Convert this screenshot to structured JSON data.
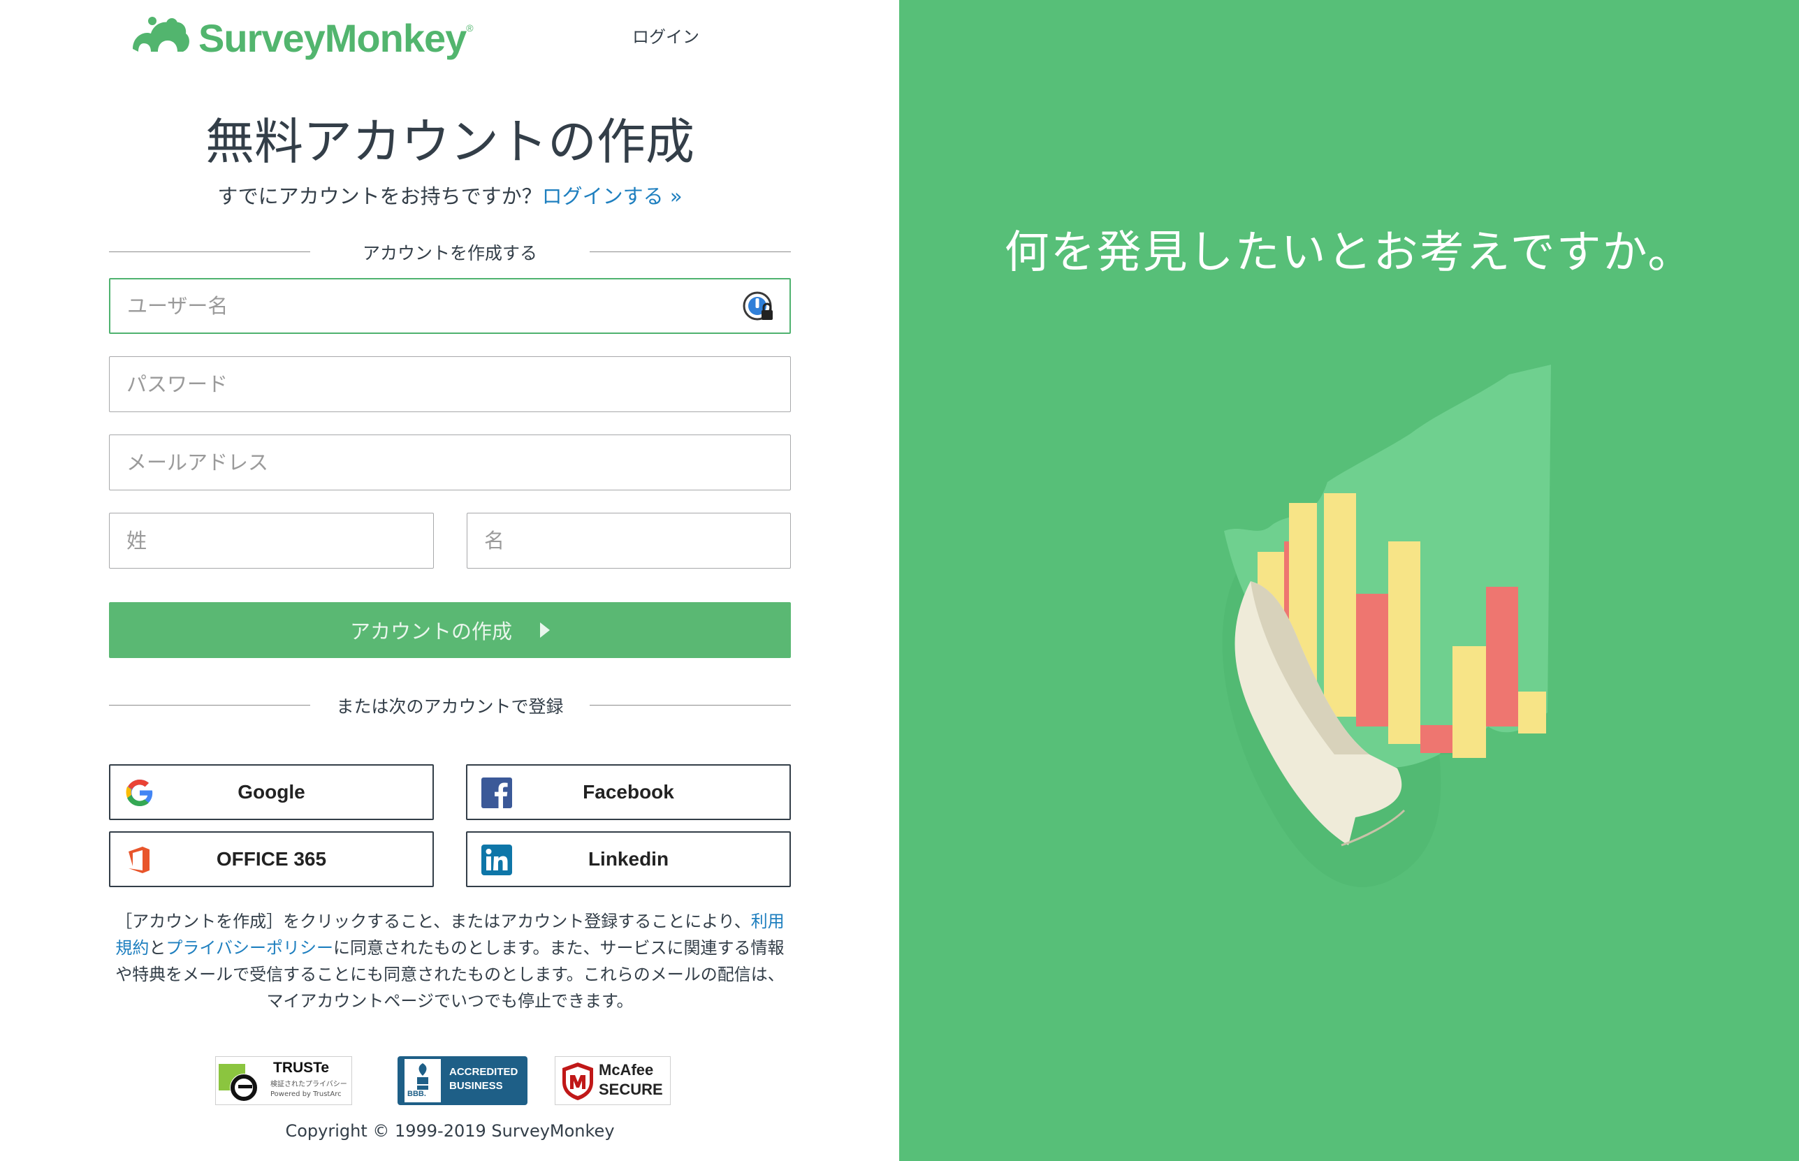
{
  "header": {
    "brand": "SurveyMonkey",
    "trademark": "®",
    "login_link": "ログイン"
  },
  "form": {
    "title": "無料アカウントの作成",
    "subtitle_prefix": "すでにアカウントをお持ちですか？",
    "subtitle_link": "ログインする »",
    "divider_label": "アカウントを作成する",
    "username_placeholder": "ユーザー名",
    "password_placeholder": "パスワード",
    "email_placeholder": "メールアドレス",
    "last_name_placeholder": "姓",
    "first_name_placeholder": "名",
    "submit_label": "アカウントの作成",
    "social_divider_label": "または次のアカウントで登録",
    "focused_field": "username"
  },
  "social": {
    "google": "Google",
    "facebook": "Facebook",
    "office365": "OFFICE 365",
    "linkedin": "Linkedin"
  },
  "legal": {
    "part1": "［アカウントを作成］をクリックすること、またはアカウント登録することにより、",
    "terms_link": "利用規約",
    "and": "と",
    "privacy_link": "プライバシーポリシー",
    "part2": "に同意されたものとします。また、サービスに関連する情報や特典をメールで受信することにも同意されたものとします。これらのメールの配信は、マイアカウントページでいつでも停止できます。"
  },
  "badges": {
    "truste_title": "TRUSTe",
    "truste_sub": "検証されたプライバシー",
    "truste_powered": "Powered by TrustArc",
    "bbb_mark": "BBB.",
    "bbb_line1": "ACCREDITED",
    "bbb_line2": "BUSINESS",
    "mcafee_line1": "McAfee",
    "mcafee_line2": "SECURE"
  },
  "footer": {
    "copyright": "Copyright © 1999-2019 SurveyMonkey"
  },
  "hero": {
    "headline": "何を発見したいとお考えですか。",
    "background_color": "#57bf78"
  },
  "colors": {
    "brand_green": "#52b56e",
    "button_green": "#5ab873",
    "link_blue": "#1e7fbf",
    "text": "#333e48"
  }
}
